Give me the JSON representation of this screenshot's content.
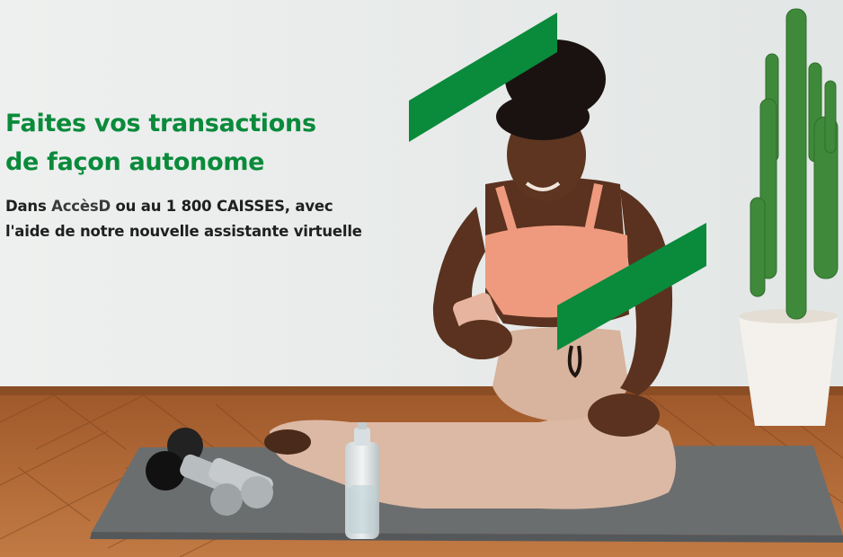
{
  "banner": {
    "headline_line1": "Faites vos transactions",
    "headline_line2": "de façon autonome",
    "subline_part1": "Dans ",
    "subline_brand": "AccèsD",
    "subline_part2": " ou au 1 800 CAISSES, avec",
    "subline_line2": "l'aide de notre nouvelle assistante virtuelle"
  },
  "colors": {
    "brand_green": "#0a8a3b",
    "wall": "#e9eceb",
    "floor": "#b06a36",
    "mat": "#6e7070"
  },
  "photo_subject": "woman seated on a yoga mat looking at a smartphone, with dumbbells, a water bottle and a potted cactus"
}
